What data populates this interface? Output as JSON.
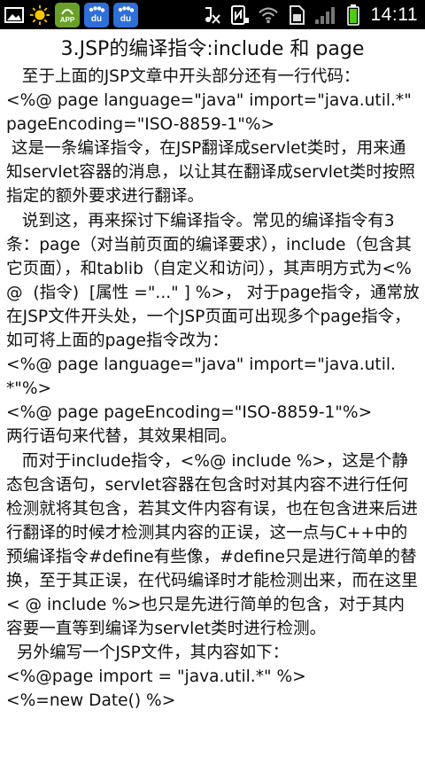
{
  "status_bar": {
    "time": "14:11",
    "notification_icons": [
      "gallery-icon",
      "weather-sun-icon",
      "app-store-icon",
      "baidu-icon",
      "baidu-icon"
    ],
    "app_store_label": "APP",
    "baidu_label": "du",
    "system_icons": [
      "headset-muted-icon",
      "nfc-icon",
      "wifi-icon",
      "sim-icon",
      "signal-icon",
      "battery-icon"
    ]
  },
  "article": {
    "title": "3.JSP的编译指令:include 和 page",
    "paragraphs": [
      "   至于上面的JSP文章中开头部分还有一行代码：",
      "<%@ page language=\"java\" import=\"java.util.*\" pageEncoding=\"ISO-8859-1\"%>",
      " 这是一条编译指令，在JSP翻译成servlet类时，用来通知servlet容器的消息，以让其在翻译成servlet类时按照指定的额外要求进行翻译。",
      "   说到这，再来探讨下编译指令。常见的编译指令有3条：page（对当前页面的编译要求），include（包含其它页面），和tablib（自定义和访问），其声明方式为<%@  (指令)  [属性 =\"...\" ] %>， 对于page指令，通常放在JSP文件开头处，一个JSP页面可出现多个page指令，如可将上面的page指令改为：",
      "<%@ page language=\"java\" import=\"java.util.*\"%>",
      "<%@ page pageEncoding=\"ISO-8859-1\"%>",
      "两行语句来代替，其效果相同。",
      "   而对于include指令，<%@ include %>，这是个静态包含语句，servlet容器在包含时对其内容不进行任何检测就将其包含，若其文件内容有误，也在包含进来后进行翻译的时候才检测其内容的正误，这一点与C++中的预编译指令#define有些像，#define只是进行简单的替换，至于其正误，在代码编译时才能检测出来，而在这里< @ include %>也只是先进行简单的包含，对于其内容要一直等到编译为servlet类时进行检测。",
      "  另外编写一个JSP文件，其内容如下：",
      "<%@page import = \"java.util.*\" %>",
      "<%=new Date() %>"
    ]
  }
}
